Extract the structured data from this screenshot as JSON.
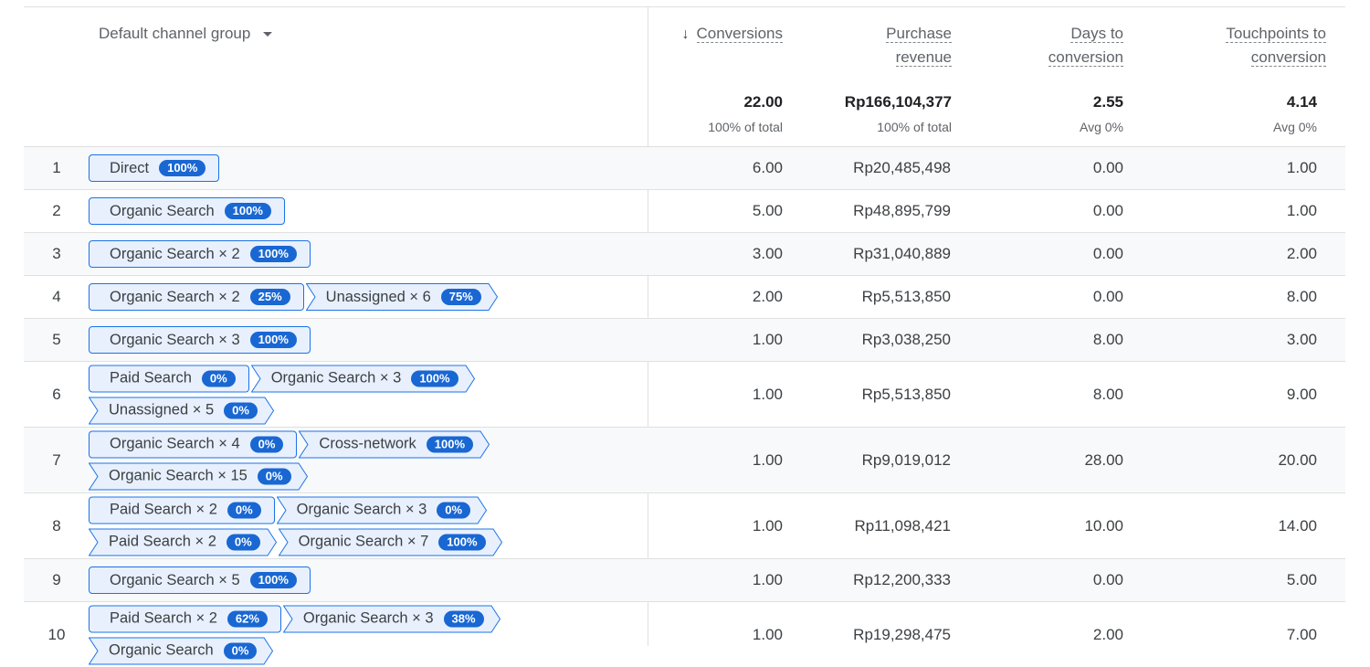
{
  "header": {
    "dimension": "Default channel group",
    "metrics": [
      {
        "lines": [
          "Conversions"
        ],
        "sorted": true
      },
      {
        "lines": [
          "Purchase",
          "revenue"
        ]
      },
      {
        "lines": [
          "Days to",
          "conversion"
        ]
      },
      {
        "lines": [
          "Touchpoints to",
          "conversion"
        ]
      }
    ],
    "sort_arrow": "↓",
    "totals": [
      {
        "value": "22.00",
        "sub": "100% of total"
      },
      {
        "value": "Rp166,104,377",
        "sub": "100% of total"
      },
      {
        "value": "2.55",
        "sub": "Avg 0%"
      },
      {
        "value": "4.14",
        "sub": "Avg 0%"
      }
    ]
  },
  "rows": [
    {
      "num": "1",
      "height": 47,
      "paths": [
        [
          {
            "label": "Direct",
            "pct": "100%"
          }
        ]
      ],
      "values": [
        "6.00",
        "Rp20,485,498",
        "0.00",
        "1.00"
      ]
    },
    {
      "num": "2",
      "height": 47,
      "paths": [
        [
          {
            "label": "Organic Search",
            "pct": "100%"
          }
        ]
      ],
      "values": [
        "5.00",
        "Rp48,895,799",
        "0.00",
        "1.00"
      ]
    },
    {
      "num": "3",
      "height": 47,
      "paths": [
        [
          {
            "label": "Organic Search × 2",
            "pct": "100%"
          }
        ]
      ],
      "values": [
        "3.00",
        "Rp31,040,889",
        "0.00",
        "2.00"
      ]
    },
    {
      "num": "4",
      "height": 47,
      "paths": [
        [
          {
            "label": "Organic Search × 2",
            "pct": "25%"
          },
          {
            "label": "Unassigned × 6",
            "pct": "75%"
          }
        ]
      ],
      "values": [
        "2.00",
        "Rp5,513,850",
        "0.00",
        "8.00"
      ]
    },
    {
      "num": "5",
      "height": 47,
      "paths": [
        [
          {
            "label": "Organic Search × 3",
            "pct": "100%"
          }
        ]
      ],
      "values": [
        "1.00",
        "Rp3,038,250",
        "8.00",
        "3.00"
      ]
    },
    {
      "num": "6",
      "height": 72,
      "paths": [
        [
          {
            "label": "Paid Search",
            "pct": "0%"
          },
          {
            "label": "Organic Search × 3",
            "pct": "100%"
          }
        ],
        [
          {
            "label": "Unassigned × 5",
            "pct": "0%"
          }
        ]
      ],
      "values": [
        "1.00",
        "Rp5,513,850",
        "8.00",
        "9.00"
      ]
    },
    {
      "num": "7",
      "height": 72,
      "paths": [
        [
          {
            "label": "Organic Search × 4",
            "pct": "0%"
          },
          {
            "label": "Cross-network",
            "pct": "100%"
          }
        ],
        [
          {
            "label": "Organic Search × 15",
            "pct": "0%"
          }
        ]
      ],
      "values": [
        "1.00",
        "Rp9,019,012",
        "28.00",
        "20.00"
      ]
    },
    {
      "num": "8",
      "height": 72,
      "paths": [
        [
          {
            "label": "Paid Search × 2",
            "pct": "0%"
          },
          {
            "label": "Organic Search × 3",
            "pct": "0%"
          }
        ],
        [
          {
            "label": "Paid Search × 2",
            "pct": "0%"
          },
          {
            "label": "Organic Search × 7",
            "pct": "100%"
          }
        ]
      ],
      "values": [
        "1.00",
        "Rp11,098,421",
        "10.00",
        "14.00"
      ]
    },
    {
      "num": "9",
      "height": 47,
      "paths": [
        [
          {
            "label": "Organic Search × 5",
            "pct": "100%"
          }
        ]
      ],
      "values": [
        "1.00",
        "Rp12,200,333",
        "0.00",
        "5.00"
      ]
    },
    {
      "num": "10",
      "height": 72,
      "paths": [
        [
          {
            "label": "Paid Search × 2",
            "pct": "62%"
          },
          {
            "label": "Organic Search × 3",
            "pct": "38%"
          }
        ],
        [
          {
            "label": "Organic Search",
            "pct": "0%"
          }
        ]
      ],
      "values": [
        "1.00",
        "Rp19,298,475",
        "2.00",
        "7.00"
      ]
    }
  ]
}
